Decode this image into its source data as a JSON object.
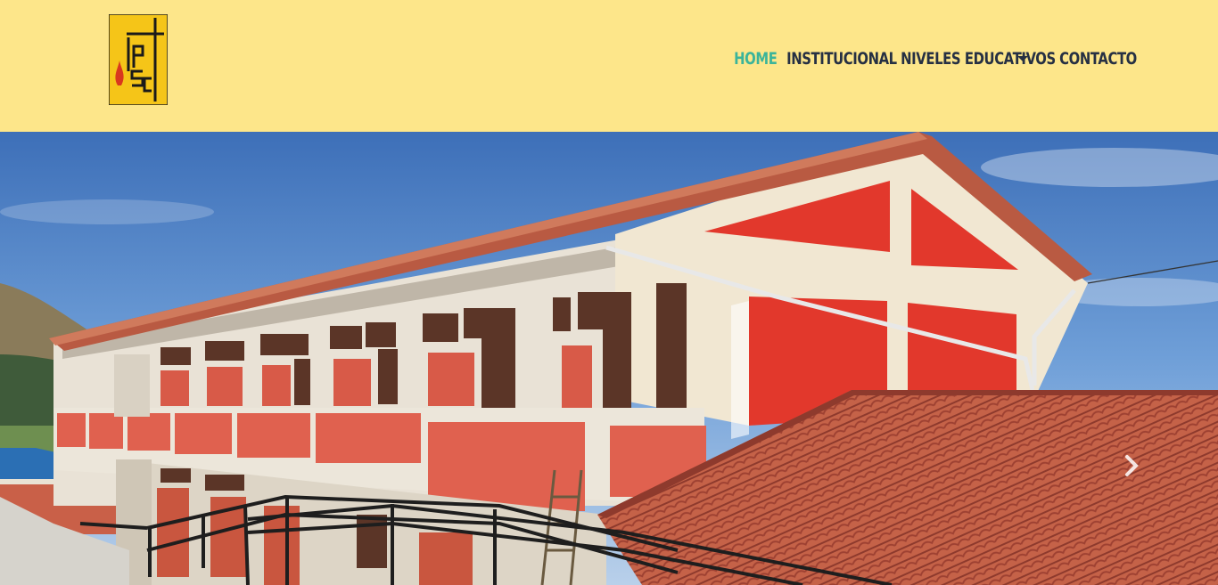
{
  "brand": {
    "logo_letters": "IPSC",
    "logo_bg": "#f5c518",
    "logo_ink": "#1a1a1a",
    "logo_flame": "#d9381e"
  },
  "nav": {
    "items": [
      {
        "label": "HOME",
        "active": true
      },
      {
        "label": "INSTITUCIONAL",
        "active": false
      },
      {
        "label": "NIVELES EDUCATIVOS",
        "active": false,
        "dropdown": true
      },
      {
        "label": "CONTACTO",
        "active": false
      }
    ],
    "active_color": "#3bb49a",
    "text_color": "#263043",
    "bg_color": "#fde68a"
  },
  "hero": {
    "image_subject": "school building with red panels and tiled roof under blue sky",
    "next_icon": "chevron-right-icon"
  }
}
